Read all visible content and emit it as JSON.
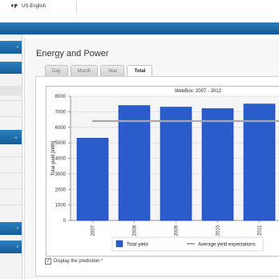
{
  "header": {
    "language": "US-English",
    "globe_icon": "globe-icon"
  },
  "page": {
    "title": "Energy and Power"
  },
  "tabs": [
    {
      "label": "Day",
      "active": false
    },
    {
      "label": "Month",
      "active": false
    },
    {
      "label": "Year",
      "active": false
    },
    {
      "label": "Total",
      "active": true
    }
  ],
  "colors": {
    "accent": "#1f68b0",
    "bar": "#2a5ccb",
    "bar_edge": "#1c3f96",
    "avg_line": "#a8a8a8"
  },
  "chart_data": {
    "type": "bar",
    "title": "WebBox: 2007 - 2012",
    "ylabel": "Total yield [kWh]",
    "xlabel": "",
    "ylim": [
      0,
      8000
    ],
    "yticks": [
      "0",
      "1000",
      "2000",
      "3000",
      "4000",
      "5000",
      "6000",
      "7000",
      "8000"
    ],
    "categories": [
      "2007",
      "2008",
      "2009",
      "2010",
      "2011"
    ],
    "series": [
      {
        "name": "Total yield",
        "values": [
          5300,
          7400,
          7300,
          7200,
          7500
        ]
      }
    ],
    "reference_line": {
      "name": "Average yield expectations",
      "value": 6400
    },
    "legend_position": "bottom",
    "grid": true
  },
  "options": {
    "show_prediction_label": "Display the prediction *",
    "show_prediction_checked": true
  }
}
